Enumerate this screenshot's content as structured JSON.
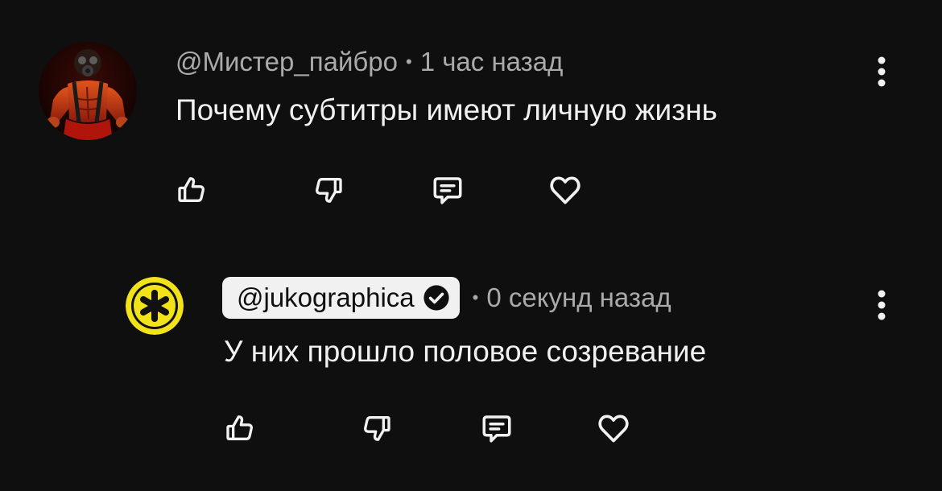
{
  "comment": {
    "author": "@Мистер_пайбро",
    "time": "1 час назад",
    "text": "Почему субтитры имеют личную жизнь",
    "icons": [
      "like-icon",
      "dislike-icon",
      "reply-icon",
      "heart-icon",
      "more-vert-icon"
    ]
  },
  "reply": {
    "author": "@jukographica",
    "verified": true,
    "time": "0 секунд назад",
    "text": "У них прошло половое созревание",
    "icons": [
      "like-icon",
      "dislike-icon",
      "reply-icon",
      "heart-icon",
      "more-vert-icon",
      "verified-check-icon"
    ]
  },
  "separator": "•",
  "colors": {
    "background": "#0f0f0f",
    "text": "#f1f1f1",
    "meta": "#aaaaaa",
    "chip": "#f1f1f1",
    "logo_yellow": "#f2e21a"
  }
}
